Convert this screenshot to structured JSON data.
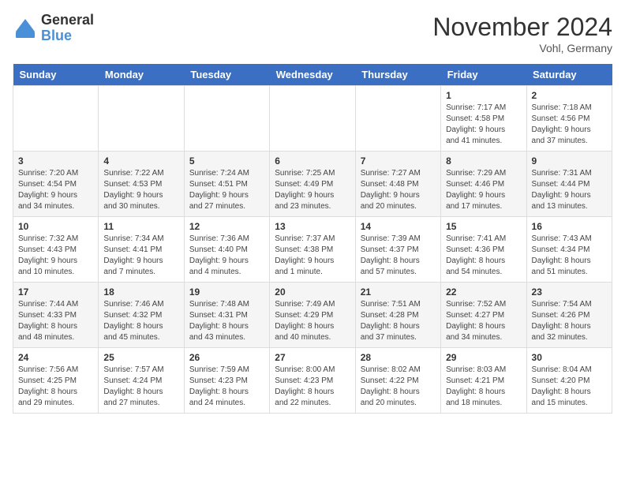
{
  "header": {
    "logo_general": "General",
    "logo_blue": "Blue",
    "title": "November 2024",
    "location": "Vohl, Germany"
  },
  "weekdays": [
    "Sunday",
    "Monday",
    "Tuesday",
    "Wednesday",
    "Thursday",
    "Friday",
    "Saturday"
  ],
  "weeks": [
    [
      {
        "day": "",
        "info": ""
      },
      {
        "day": "",
        "info": ""
      },
      {
        "day": "",
        "info": ""
      },
      {
        "day": "",
        "info": ""
      },
      {
        "day": "",
        "info": ""
      },
      {
        "day": "1",
        "info": "Sunrise: 7:17 AM\nSunset: 4:58 PM\nDaylight: 9 hours\nand 41 minutes."
      },
      {
        "day": "2",
        "info": "Sunrise: 7:18 AM\nSunset: 4:56 PM\nDaylight: 9 hours\nand 37 minutes."
      }
    ],
    [
      {
        "day": "3",
        "info": "Sunrise: 7:20 AM\nSunset: 4:54 PM\nDaylight: 9 hours\nand 34 minutes."
      },
      {
        "day": "4",
        "info": "Sunrise: 7:22 AM\nSunset: 4:53 PM\nDaylight: 9 hours\nand 30 minutes."
      },
      {
        "day": "5",
        "info": "Sunrise: 7:24 AM\nSunset: 4:51 PM\nDaylight: 9 hours\nand 27 minutes."
      },
      {
        "day": "6",
        "info": "Sunrise: 7:25 AM\nSunset: 4:49 PM\nDaylight: 9 hours\nand 23 minutes."
      },
      {
        "day": "7",
        "info": "Sunrise: 7:27 AM\nSunset: 4:48 PM\nDaylight: 9 hours\nand 20 minutes."
      },
      {
        "day": "8",
        "info": "Sunrise: 7:29 AM\nSunset: 4:46 PM\nDaylight: 9 hours\nand 17 minutes."
      },
      {
        "day": "9",
        "info": "Sunrise: 7:31 AM\nSunset: 4:44 PM\nDaylight: 9 hours\nand 13 minutes."
      }
    ],
    [
      {
        "day": "10",
        "info": "Sunrise: 7:32 AM\nSunset: 4:43 PM\nDaylight: 9 hours\nand 10 minutes."
      },
      {
        "day": "11",
        "info": "Sunrise: 7:34 AM\nSunset: 4:41 PM\nDaylight: 9 hours\nand 7 minutes."
      },
      {
        "day": "12",
        "info": "Sunrise: 7:36 AM\nSunset: 4:40 PM\nDaylight: 9 hours\nand 4 minutes."
      },
      {
        "day": "13",
        "info": "Sunrise: 7:37 AM\nSunset: 4:38 PM\nDaylight: 9 hours\nand 1 minute."
      },
      {
        "day": "14",
        "info": "Sunrise: 7:39 AM\nSunset: 4:37 PM\nDaylight: 8 hours\nand 57 minutes."
      },
      {
        "day": "15",
        "info": "Sunrise: 7:41 AM\nSunset: 4:36 PM\nDaylight: 8 hours\nand 54 minutes."
      },
      {
        "day": "16",
        "info": "Sunrise: 7:43 AM\nSunset: 4:34 PM\nDaylight: 8 hours\nand 51 minutes."
      }
    ],
    [
      {
        "day": "17",
        "info": "Sunrise: 7:44 AM\nSunset: 4:33 PM\nDaylight: 8 hours\nand 48 minutes."
      },
      {
        "day": "18",
        "info": "Sunrise: 7:46 AM\nSunset: 4:32 PM\nDaylight: 8 hours\nand 45 minutes."
      },
      {
        "day": "19",
        "info": "Sunrise: 7:48 AM\nSunset: 4:31 PM\nDaylight: 8 hours\nand 43 minutes."
      },
      {
        "day": "20",
        "info": "Sunrise: 7:49 AM\nSunset: 4:29 PM\nDaylight: 8 hours\nand 40 minutes."
      },
      {
        "day": "21",
        "info": "Sunrise: 7:51 AM\nSunset: 4:28 PM\nDaylight: 8 hours\nand 37 minutes."
      },
      {
        "day": "22",
        "info": "Sunrise: 7:52 AM\nSunset: 4:27 PM\nDaylight: 8 hours\nand 34 minutes."
      },
      {
        "day": "23",
        "info": "Sunrise: 7:54 AM\nSunset: 4:26 PM\nDaylight: 8 hours\nand 32 minutes."
      }
    ],
    [
      {
        "day": "24",
        "info": "Sunrise: 7:56 AM\nSunset: 4:25 PM\nDaylight: 8 hours\nand 29 minutes."
      },
      {
        "day": "25",
        "info": "Sunrise: 7:57 AM\nSunset: 4:24 PM\nDaylight: 8 hours\nand 27 minutes."
      },
      {
        "day": "26",
        "info": "Sunrise: 7:59 AM\nSunset: 4:23 PM\nDaylight: 8 hours\nand 24 minutes."
      },
      {
        "day": "27",
        "info": "Sunrise: 8:00 AM\nSunset: 4:23 PM\nDaylight: 8 hours\nand 22 minutes."
      },
      {
        "day": "28",
        "info": "Sunrise: 8:02 AM\nSunset: 4:22 PM\nDaylight: 8 hours\nand 20 minutes."
      },
      {
        "day": "29",
        "info": "Sunrise: 8:03 AM\nSunset: 4:21 PM\nDaylight: 8 hours\nand 18 minutes."
      },
      {
        "day": "30",
        "info": "Sunrise: 8:04 AM\nSunset: 4:20 PM\nDaylight: 8 hours\nand 15 minutes."
      }
    ]
  ]
}
